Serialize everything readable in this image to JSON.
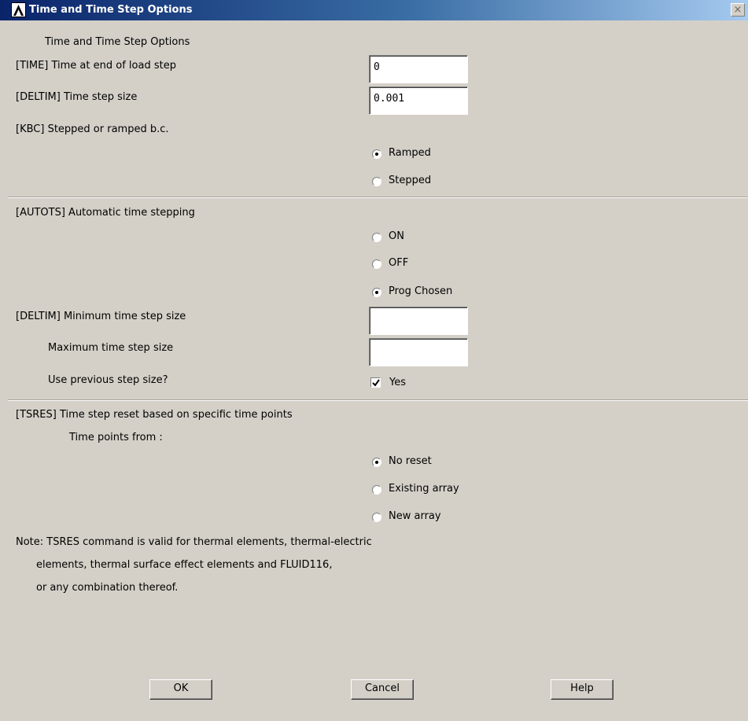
{
  "window": {
    "title": "Time and Time Step Options",
    "close_glyph": "×",
    "app_icon": "ansys-logo-icon"
  },
  "header": "Time and Time Step Options",
  "time": {
    "label": "[TIME]  Time at end of load step",
    "value": "0"
  },
  "deltim": {
    "label": "[DELTIM]  Time step size",
    "value": "0.001"
  },
  "kbc": {
    "label": "[KBC]     Stepped or ramped b.c.",
    "options": [
      {
        "label": "Ramped",
        "selected": true
      },
      {
        "label": "Stepped",
        "selected": false
      }
    ]
  },
  "autots": {
    "label": "[AUTOTS] Automatic time stepping",
    "options": [
      {
        "label": "ON",
        "selected": false
      },
      {
        "label": "OFF",
        "selected": false
      },
      {
        "label": "Prog Chosen",
        "selected": true
      }
    ]
  },
  "deltim_min": {
    "label": "[DELTIM] Minimum time step size",
    "value": ""
  },
  "deltim_max": {
    "label": "Maximum time step size",
    "value": ""
  },
  "use_previous": {
    "label": "Use previous step size?",
    "checkbox_label": "Yes",
    "checked": true
  },
  "tsres": {
    "label": "[TSRES]  Time step reset based on specific time points",
    "sublabel": "Time points from :",
    "options": [
      {
        "label": "No reset",
        "selected": true
      },
      {
        "label": "Existing array",
        "selected": false
      },
      {
        "label": "New array",
        "selected": false
      }
    ]
  },
  "note": [
    "Note: TSRES command is valid for thermal elements, thermal-electric",
    "elements, thermal surface effect elements and FLUID116,",
    "or any combination thereof."
  ],
  "buttons": {
    "ok": "OK",
    "cancel": "Cancel",
    "help": "Help"
  },
  "colors": {
    "dialog_bg": "#d4d0c8",
    "titlebar": "#0a246a"
  }
}
